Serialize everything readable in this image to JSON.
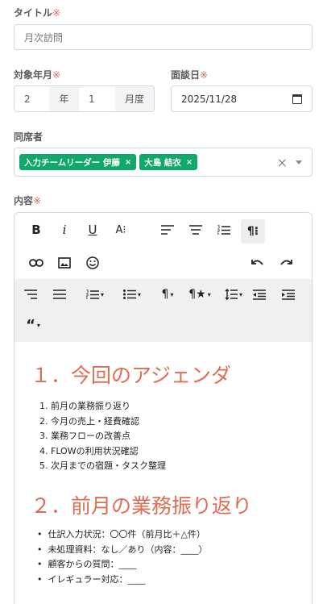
{
  "form": {
    "title_label": "タイトル",
    "required_mark": "※",
    "title_placeholder": "月次訪問",
    "target_month_label": "対象年月",
    "year_value": "2",
    "year_addon": "年",
    "month_value": "1",
    "month_addon": "月度",
    "meeting_date_label": "面談日",
    "meeting_date_value": "2025/11/28",
    "attendees_label": "同席者",
    "attendees": [
      {
        "name": "入力チームリーダー 伊藤"
      },
      {
        "name": "大島 結衣"
      }
    ],
    "content_label": "内容"
  },
  "editor": {
    "heading1": "１．今回のアジェンダ",
    "agenda": [
      "1. 前月の業務振り返り",
      "2. 今月の売上・経費確認",
      "3. 業務フローの改善点",
      "4. FLOWの利用状況確認",
      "5. 次月までの宿題・タスク整理"
    ],
    "heading2": "２．前月の業務振り返り",
    "review_items": [
      "仕訳入力状況：〇〇件（前月比＋△件）",
      "未処理資料：なし／あり（内容：____）",
      "顧客からの質問：____",
      "イレギュラー対応：____"
    ]
  },
  "icons": {
    "bold": "B",
    "italic": "i",
    "underline": "U",
    "text_size": "A⁝",
    "remove": "×",
    "caret": "▾"
  },
  "colors": {
    "tag_green": "#11a86b",
    "heading_red": "#e06c54",
    "required_red": "#e06666"
  }
}
